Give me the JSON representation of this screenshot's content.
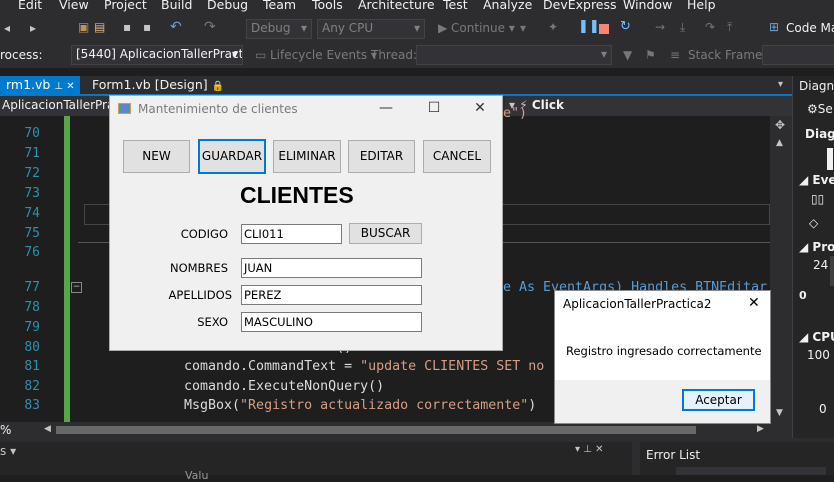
{
  "menu": [
    "Edit",
    "View",
    "Project",
    "Build",
    "Debug",
    "Team",
    "Tools",
    "Architecture",
    "Test",
    "Analyze",
    "DevExpress",
    "Window",
    "Help"
  ],
  "toolbar": {
    "config": "Debug",
    "platform": "Any CPU",
    "continue": "Continue",
    "code_map": "Code Map"
  },
  "toolbar2": {
    "process_label": "rocess:",
    "process_value": "[5440] AplicacionTallerPractica2.vs",
    "lifecycle": "Lifecycle Events",
    "thread": "Thread:",
    "stack_frame": "Stack Frame:"
  },
  "doc_tabs": [
    "rm1.vb",
    "Form1.vb [Design]"
  ],
  "navbar": {
    "left": "AplicacionTallerPractic",
    "right": "Click"
  },
  "editor": {
    "line_numbers": [
      "70",
      "71",
      "72",
      "73",
      "74",
      "75",
      "76",
      "77",
      "78",
      "79",
      "80",
      "81",
      "82",
      "83"
    ],
    "frag_top": "e\")",
    "frag_77": "e As EventArgs) Handles BTNEditar",
    "line_80": "comando = ...ommand()",
    "line_81_a": "comando.CommandText = ",
    "line_81_b": "\"update CLIENTES SET no",
    "line_82": "comando.ExecuteNonQuery()",
    "line_83_a": "MsgBox(",
    "line_83_b": "\"Registro actualizado correctamente\"",
    "line_83_c": ")"
  },
  "zoom": "%",
  "bottom": {
    "error_list": "Error List",
    "value_col": "Valu"
  },
  "right_panel": {
    "title": "Diagno",
    "settings": "Se",
    "diag": "Diagn",
    "events": "Even",
    "process": "Proc",
    "proc_value": "24",
    "cpu": "CPU",
    "cpu_value": "100",
    "zero_a": "0",
    "zero_b": "0"
  },
  "form": {
    "title": "Mantenimiento de clientes",
    "buttons": {
      "new": "NEW",
      "save": "GUARDAR",
      "delete": "ELIMINAR",
      "edit": "EDITAR",
      "cancel": "CANCEL"
    },
    "heading": "CLIENTES",
    "labels": {
      "codigo": "CODIGO",
      "nombres": "NOMBRES",
      "apellidos": "APELLIDOS",
      "sexo": "SEXO"
    },
    "values": {
      "codigo": "CLI011",
      "nombres": "JUAN",
      "apellidos": "PEREZ",
      "sexo": "MASCULINO"
    },
    "search_button": "BUSCAR"
  },
  "msgbox": {
    "title": "AplicacionTallerPractica2",
    "message": "Registro ingresado correctamente",
    "ok": "Aceptar"
  }
}
